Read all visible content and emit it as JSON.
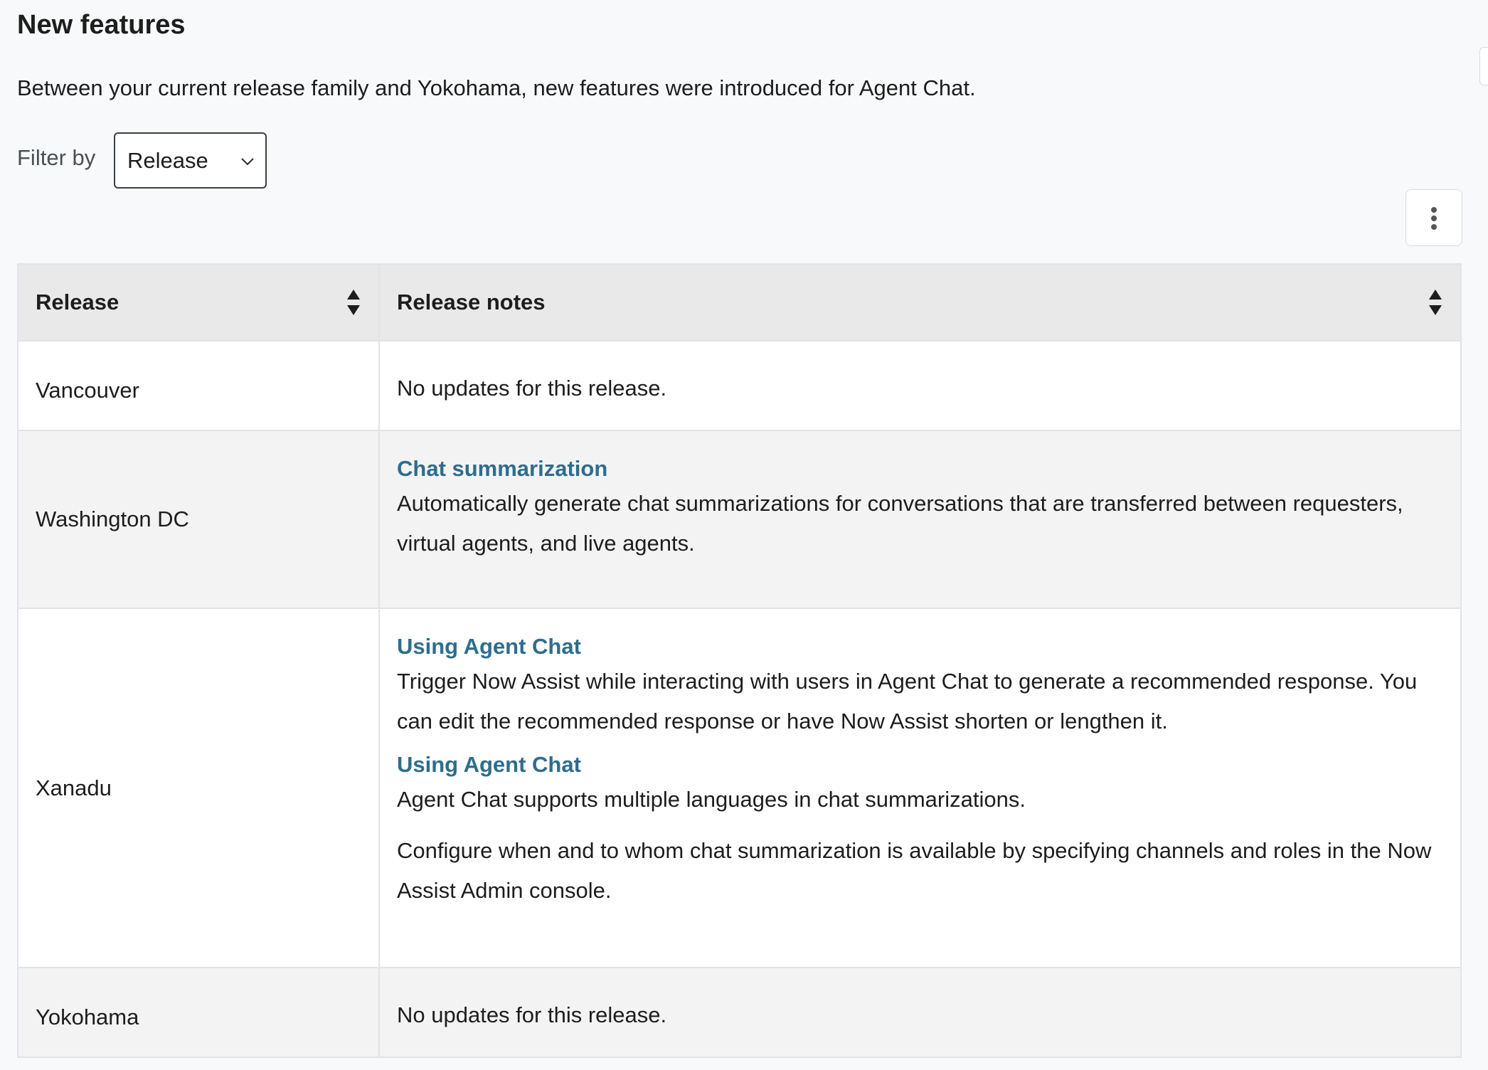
{
  "page": {
    "title": "New features",
    "intro": "Between your current release family and Yokohama, new features were introduced for Agent Chat."
  },
  "filter": {
    "label": "Filter by",
    "selected": "Release"
  },
  "icons": {
    "more": "more-vertical-icon",
    "sort": "sort-icon",
    "chevron": "chevron-down-icon"
  },
  "table": {
    "headers": [
      "Release",
      "Release notes"
    ],
    "rows": [
      {
        "release": "Vancouver",
        "text": "No updates for this release."
      },
      {
        "release": "Washington DC",
        "notes": [
          {
            "link": "Chat summarization",
            "text": "Automatically generate chat summarizations for conversations that are transferred between requesters, virtual agents, and live agents."
          }
        ]
      },
      {
        "release": "Xanadu",
        "notes": [
          {
            "link": "Using Agent Chat",
            "text": "Trigger Now Assist while interacting with users in Agent Chat to generate a recommended response. You can edit the recommended response or have Now Assist shorten or lengthen it."
          },
          {
            "link": "Using Agent Chat",
            "text": "Agent Chat supports multiple languages in chat summarizations.",
            "extra": "Configure when and to whom chat summarization is available by specifying channels and roles in the Now Assist Admin console."
          }
        ]
      },
      {
        "release": "Yokohama",
        "text": "No updates for this release."
      }
    ]
  },
  "colors": {
    "link": "#2e6d8e",
    "header_bg": "#e9e9ea",
    "row_alt": "#f3f3f3",
    "border": "#e1e3e6"
  }
}
